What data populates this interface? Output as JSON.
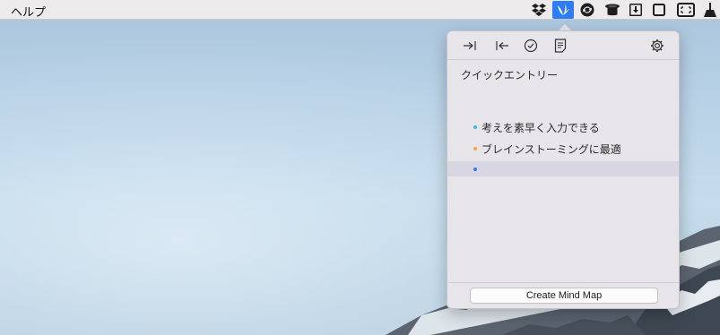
{
  "menubar": {
    "help_label": "ヘルプ",
    "tray_icons": [
      "dropbox-icon",
      "mindnode-icon",
      "sync-icon",
      "hat-icon",
      "download-icon",
      "window-icon",
      "screenshot-icon",
      "broom-icon"
    ],
    "active_icon": "mindnode-icon",
    "accent_color": "#2e7cf6"
  },
  "popover": {
    "toolbar": {
      "buttons": [
        "indent-icon",
        "outdent-icon",
        "check-icon",
        "note-icon"
      ],
      "settings": "gear-icon"
    },
    "outline": {
      "root": "クイックエントリー",
      "items": [
        {
          "text": "考えを素早く入力できる",
          "bullet_color": "#43b8d9"
        },
        {
          "text": "ブレインストーミングに最適",
          "bullet_color": "#f0a63c"
        },
        {
          "text": "",
          "bullet_color": "#2e7cf6"
        }
      ]
    },
    "create_button": "Create Mind Map"
  }
}
